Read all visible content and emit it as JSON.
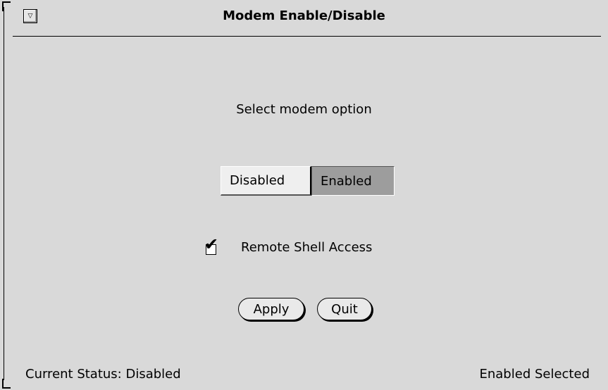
{
  "window": {
    "title": "Modem Enable/Disable",
    "menu_glyph": "▽"
  },
  "main": {
    "prompt": "Select modem option",
    "options": [
      {
        "label": "Disabled",
        "selected": false
      },
      {
        "label": "Enabled",
        "selected": true
      }
    ],
    "checkbox": {
      "label": "Remote Shell Access",
      "checked": true,
      "mark": "✔"
    },
    "buttons": {
      "apply": "Apply",
      "quit": "Quit"
    }
  },
  "footer": {
    "left": "Current Status: Disabled",
    "right": "Enabled Selected"
  },
  "colors": {
    "window_bg": "#d9d9d9",
    "selected_bg": "#9d9d9d"
  }
}
